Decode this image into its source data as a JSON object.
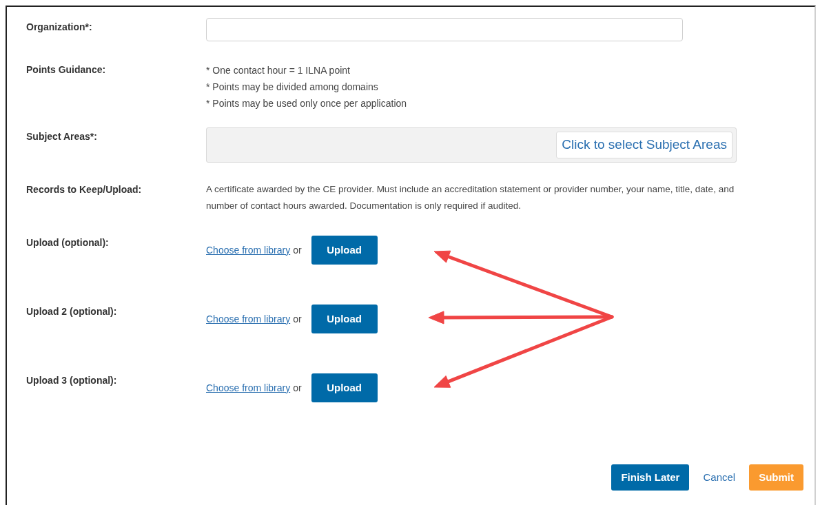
{
  "fields": [
    {
      "kind": "input",
      "label": "Organization*:"
    },
    {
      "kind": "list",
      "label": "Points Guidance:",
      "lines": [
        "* One contact hour = 1 ILNA point",
        "* Points may be divided among domains",
        "* Points may be used only once per application"
      ]
    },
    {
      "kind": "select",
      "label": "Subject Areas*:",
      "button": "Click to select Subject Areas"
    },
    {
      "kind": "text",
      "label": "Records to Keep/Upload:",
      "text": "A certificate awarded by the CE provider. Must include an accreditation statement or provider number, your name, title, date, and number of contact hours awarded. Documentation is only required if audited."
    },
    {
      "kind": "upload",
      "label": "Upload (optional):",
      "link": "Choose from library",
      "separator": "or",
      "button": "Upload"
    },
    {
      "kind": "upload",
      "label": "Upload 2 (optional):",
      "link": "Choose from library",
      "separator": "or",
      "button": "Upload"
    },
    {
      "kind": "upload",
      "label": "Upload 3 (optional):",
      "link": "Choose from library",
      "separator": "or",
      "button": "Upload"
    }
  ],
  "footer": {
    "buttons": [
      {
        "kind": "primary",
        "label": "Finish Later"
      },
      {
        "kind": "link",
        "label": "Cancel"
      },
      {
        "kind": "accent",
        "label": "Submit"
      }
    ]
  }
}
